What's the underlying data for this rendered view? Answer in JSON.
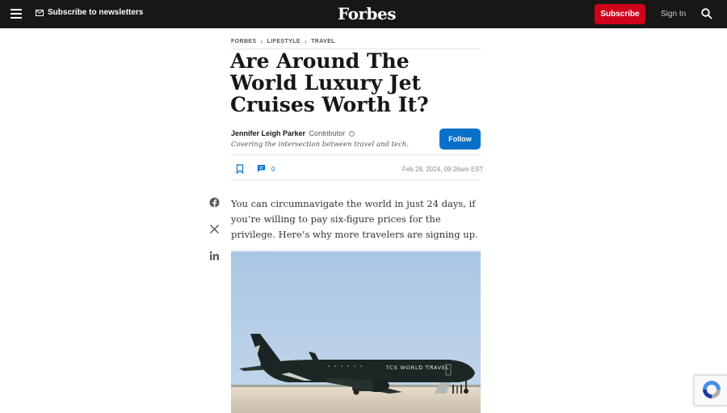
{
  "nav": {
    "newsletter_label": "Subscribe to newsletters",
    "logo": "Forbes",
    "subscribe_label": "Subscribe",
    "signin_label": "Sign In"
  },
  "breadcrumb": [
    "FORBES",
    "LIFESTYLE",
    "TRAVEL"
  ],
  "article": {
    "title": "Are Around The World Luxury Jet Cruises Worth It?",
    "author_name": "Jennifer Leigh Parker",
    "author_role": "Contributor",
    "author_desc": "Covering the intersection between travel and tech.",
    "follow_label": "Follow",
    "comment_count": "0",
    "date": "Feb 28, 2024, 09:26am EST",
    "summary": "You can circumnavigate the world in just 24 days, if you’re willing to pay six-figure prices for the privilege. Here’s why more travelers are signing up.",
    "aircraft_livery": "TCS WORLD TRAVEL"
  },
  "icons": {
    "share": [
      "facebook-icon",
      "x-icon",
      "linkedin-icon"
    ]
  },
  "colors": {
    "nav_bg": "#181716",
    "subscribe": "#d0021b",
    "follow": "#0771c9"
  }
}
